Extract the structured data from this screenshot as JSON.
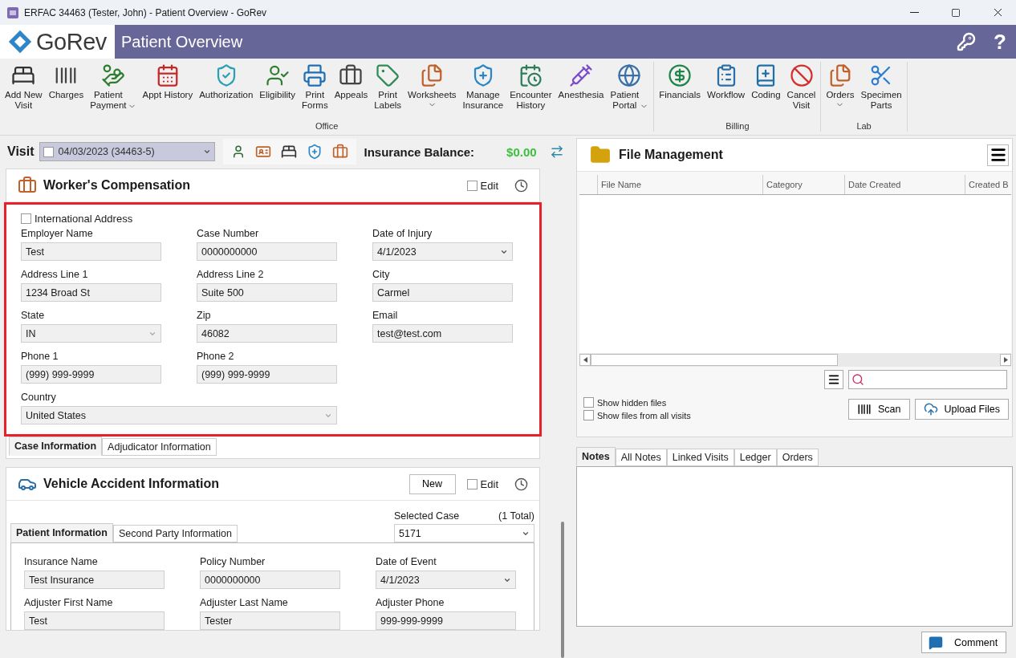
{
  "window": {
    "title": "ERFAC 34463 (Tester, John) - Patient Overview - GoRev"
  },
  "header": {
    "logo": "GoRev",
    "title": "Patient Overview",
    "help": "?"
  },
  "ribbon": {
    "groups": [
      {
        "label": "Office",
        "buttons": [
          {
            "label": "Add New\nVisit",
            "dropdown": false
          },
          {
            "label": "Charges",
            "dropdown": false
          },
          {
            "label": "Patient\nPayment",
            "dropdown": true
          },
          {
            "label": "Appt History",
            "dropdown": false
          },
          {
            "label": "Authorization",
            "dropdown": false
          },
          {
            "label": "Eligibility",
            "dropdown": false
          },
          {
            "label": "Print\nForms",
            "dropdown": false
          },
          {
            "label": "Appeals",
            "dropdown": false
          },
          {
            "label": "Print\nLabels",
            "dropdown": false
          },
          {
            "label": "Worksheets",
            "dropdown": true
          },
          {
            "label": "Manage\nInsurance",
            "dropdown": false
          },
          {
            "label": "Encounter\nHistory",
            "dropdown": false
          },
          {
            "label": "Anesthesia",
            "dropdown": false
          },
          {
            "label": "Patient\nPortal",
            "dropdown": true
          }
        ]
      },
      {
        "label": "Billing",
        "buttons": [
          {
            "label": "Financials",
            "dropdown": false
          },
          {
            "label": "Workflow",
            "dropdown": false
          },
          {
            "label": "Coding",
            "dropdown": false
          },
          {
            "label": "Cancel\nVisit",
            "dropdown": false
          }
        ]
      },
      {
        "label": "Lab",
        "buttons": [
          {
            "label": "Orders",
            "dropdown": true
          },
          {
            "label": "Specimen\nParts",
            "dropdown": false
          }
        ]
      }
    ]
  },
  "visit_bar": {
    "label": "Visit",
    "visit": {
      "checked": false,
      "value": "04/03/2023 (34463-5)"
    },
    "balance_label": "Insurance Balance:",
    "balance": "$0.00"
  },
  "workers_comp": {
    "title": "Worker's Compensation",
    "edit": {
      "label": "Edit",
      "checked": false
    },
    "highlighted": true,
    "international_address": {
      "label": "International Address",
      "checked": false
    },
    "fields": [
      {
        "label": "Employer Name",
        "value": "Test",
        "kind": "text"
      },
      {
        "label": "Case Number",
        "value": "0000000000",
        "kind": "text"
      },
      {
        "label": "Date of Injury",
        "value": "4/1/2023",
        "kind": "date"
      },
      {
        "label": "Address Line 1",
        "value": "1234 Broad St",
        "kind": "text"
      },
      {
        "label": "Address Line 2",
        "value": "Suite 500",
        "kind": "text"
      },
      {
        "label": "City",
        "value": "Carmel",
        "kind": "text"
      },
      {
        "label": "State",
        "value": "IN",
        "kind": "select"
      },
      {
        "label": "Zip",
        "value": "46082",
        "kind": "text"
      },
      {
        "label": "Email",
        "value": "test@test.com",
        "kind": "text"
      },
      {
        "label": "Phone 1",
        "value": "(999) 999-9999",
        "kind": "text"
      },
      {
        "label": "Phone 2",
        "value": "(999) 999-9999",
        "kind": "text"
      }
    ],
    "country": {
      "label": "Country",
      "value": "United States"
    },
    "tabs": [
      {
        "label": "Case Information",
        "selected": true
      },
      {
        "label": "Adjudicator Information",
        "selected": false
      }
    ]
  },
  "vehicle_accident": {
    "title": "Vehicle Accident Information",
    "new_button": "New",
    "edit": {
      "label": "Edit",
      "checked": false
    },
    "selected_case": {
      "label": "Selected Case",
      "total": "(1 Total)",
      "value": "5171"
    },
    "tabs": [
      {
        "label": "Patient Information",
        "selected": true
      },
      {
        "label": "Second Party Information",
        "selected": false
      }
    ],
    "fields": [
      {
        "label": "Insurance Name",
        "value": "Test Insurance",
        "kind": "text"
      },
      {
        "label": "Policy Number",
        "value": "0000000000",
        "kind": "text"
      },
      {
        "label": "Date of Event",
        "value": "4/1/2023",
        "kind": "date"
      },
      {
        "label": "Adjuster First Name",
        "value": "Test",
        "kind": "text"
      },
      {
        "label": "Adjuster Last Name",
        "value": "Tester",
        "kind": "text"
      },
      {
        "label": "Adjuster Phone",
        "value": "999-999-9999",
        "kind": "text"
      }
    ]
  },
  "file_management": {
    "title": "File Management",
    "columns": [
      "File Name",
      "Category",
      "Date Created",
      "Created B"
    ],
    "options": [
      {
        "label": "Show hidden files",
        "checked": false
      },
      {
        "label": "Show files from all visits",
        "checked": false
      }
    ],
    "buttons": [
      {
        "label": "Scan"
      },
      {
        "label": "Upload Files"
      }
    ]
  },
  "notes": {
    "tabs": [
      {
        "label": "Notes",
        "selected": true
      },
      {
        "label": "All Notes",
        "selected": false
      },
      {
        "label": "Linked Visits",
        "selected": false
      },
      {
        "label": "Ledger",
        "selected": false
      },
      {
        "label": "Orders",
        "selected": false
      }
    ],
    "comment_button": "Comment"
  }
}
